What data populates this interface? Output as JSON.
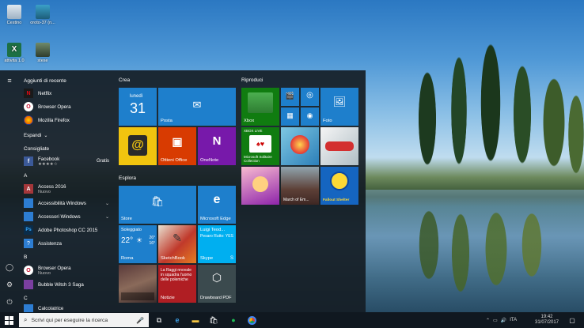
{
  "desktop": {
    "icons": [
      {
        "label": "Cestino",
        "icon": "recycle-bin-icon"
      },
      {
        "label": "oroto-37 (n...",
        "icon": "video-file-icon"
      },
      {
        "label": "attivita 1.0",
        "icon": "excel-file-icon"
      },
      {
        "label": "stese",
        "icon": "image-file-icon"
      }
    ]
  },
  "start_menu": {
    "recent_header": "Aggiunti di recente",
    "recent": [
      {
        "name": "Netflix",
        "color": "#1a1a1a"
      },
      {
        "name": "Browser Opera",
        "color": "#c8102e"
      },
      {
        "name": "Mozilla Firefox",
        "color": "#e66000"
      }
    ],
    "expand_label": "Espandi",
    "suggested_header": "Consigliate",
    "suggested": {
      "name": "Facebook",
      "rating": "★★★★☆",
      "price": "Gratis",
      "color": "#3b5998"
    },
    "letter_a": "A",
    "apps_a": [
      {
        "name": "Access 2016",
        "sub": "Nuovo",
        "color": "#a4373a"
      },
      {
        "name": "Accessibilità Windows",
        "color": "#2d7dd2"
      },
      {
        "name": "Accessori Windows",
        "color": "#2d7dd2"
      },
      {
        "name": "Adobe Photoshop CC 2015",
        "color": "#0a2c4a"
      },
      {
        "name": "Assistenza",
        "color": "#2d7dd2"
      }
    ],
    "letter_b": "B",
    "apps_b": [
      {
        "name": "Browser Opera",
        "sub": "Nuovo",
        "color": "#c8102e"
      },
      {
        "name": "Bubble Witch 3 Saga",
        "color": "#7b3fa0"
      }
    ],
    "letter_c": "C",
    "apps_c": [
      {
        "name": "Calcolatrice",
        "color": "#2d7dd2"
      }
    ],
    "groups": {
      "crea": "Crea",
      "esplora": "Esplora",
      "riproduci": "Riproduci"
    },
    "tiles": {
      "calendar_day": "lunedì",
      "calendar_date": "31",
      "mail": "Posta",
      "office": "Ottieni Office",
      "onenote": "OneNote",
      "store": "Store",
      "edge": "Microsoft Edge",
      "weather_title": "Soleggiato",
      "weather_temp": "22°",
      "weather_hi": "26°",
      "weather_lo": "16°",
      "weather_city": "Roma",
      "skype_name": "Luigi Teod...",
      "skype_msg": "Pesaro Rutto: YES,...",
      "skype_label": "Skype",
      "sketchbook": "SketchBook",
      "news_headline": "La Raggi nnovale in squadra l'uomo delle polemiche",
      "news_label": "Notizie",
      "drawboard": "Drawboard PDF",
      "xbox": "Xbox",
      "photos": "Foto",
      "xbox_live": "XBOX LIVE",
      "solitaire": "Microsoft Solitaire Collection",
      "march_of_empires": "March of Em...",
      "fallout": "Fallout Shelter"
    }
  },
  "taskbar": {
    "search_placeholder": "Scrivi qui per eseguire la ricerca",
    "language": "ITA",
    "time": "19:42",
    "date": "31/07/2017"
  },
  "colors": {
    "tile_blue": "#1e7fcc",
    "office_orange": "#d83b01",
    "onenote_purple": "#7719aa",
    "xbox_green": "#107c10",
    "start_bg": "#161e26"
  }
}
